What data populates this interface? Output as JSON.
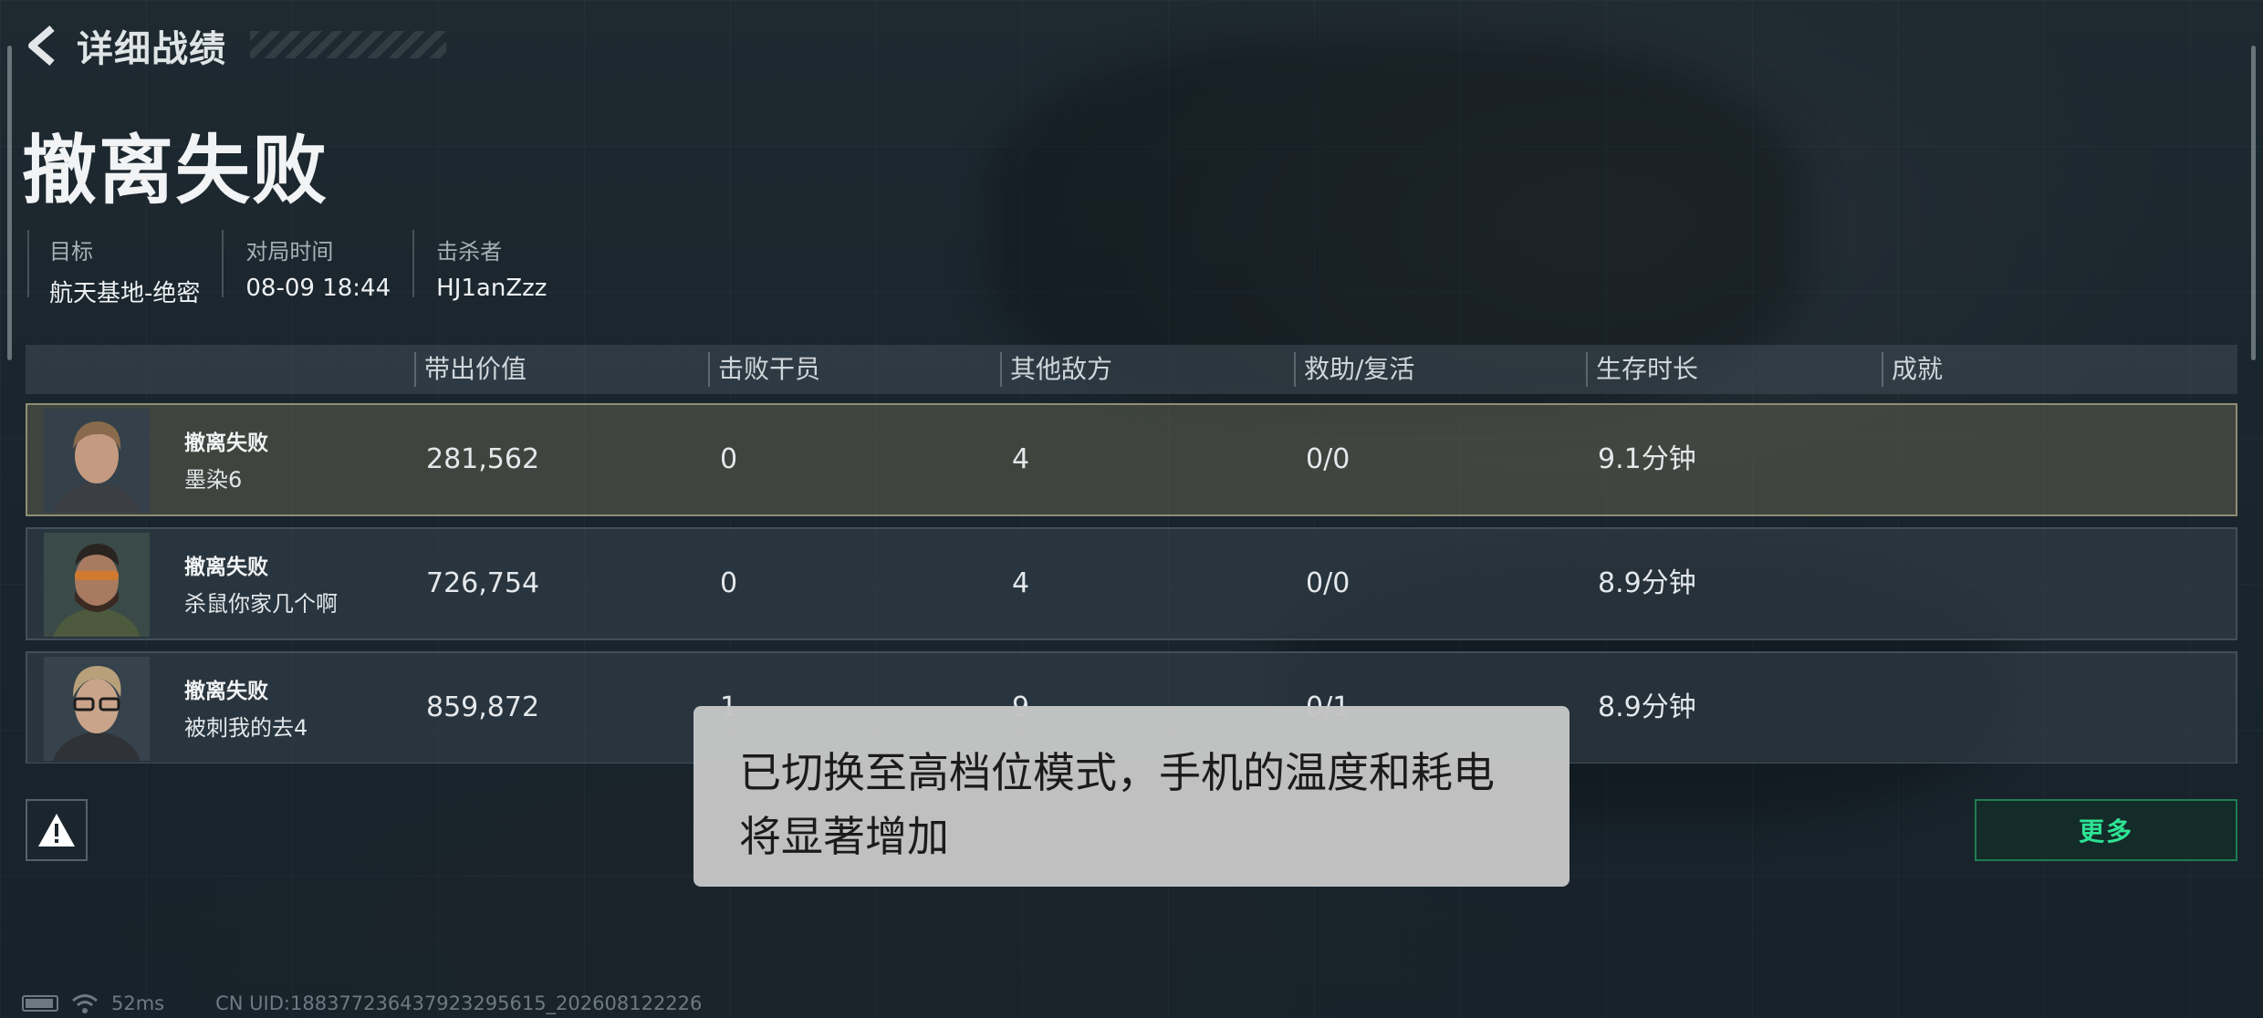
{
  "header": {
    "title": "详细战绩"
  },
  "result_title": "撤离失败",
  "info": [
    {
      "label": "目标",
      "value": "航天基地-绝密"
    },
    {
      "label": "对局时间",
      "value": "08-09 18:44"
    },
    {
      "label": "击杀者",
      "value": "HJ1anZzz"
    }
  ],
  "table": {
    "columns": [
      "带出价值",
      "击败干员",
      "其他敌方",
      "救助/复活",
      "生存时长",
      "成就"
    ],
    "rows": [
      {
        "status": "撤离失败",
        "name": "墨染6",
        "value": "281,562",
        "kills": "0",
        "other": "4",
        "assist": "0/0",
        "time": "9.1分钟",
        "selected": true
      },
      {
        "status": "撤离失败",
        "name": "杀鼠你家几个啊",
        "value": "726,754",
        "kills": "0",
        "other": "4",
        "assist": "0/0",
        "time": "8.9分钟",
        "selected": false
      },
      {
        "status": "撤离失败",
        "name": "被刺我的去4",
        "value": "859,872",
        "kills": "1",
        "other": "9",
        "assist": "0/1",
        "time": "8.9分钟",
        "selected": false
      }
    ]
  },
  "buttons": {
    "more": "更多"
  },
  "toast": {
    "line1": "已切换至高档位模式，手机的温度和耗电",
    "line2": "将显著增加"
  },
  "statusbar": {
    "ping": "52ms",
    "uid": "CN UID:18837723643792329561​5_202608122226"
  },
  "colors": {
    "accent_green": "#2ee394",
    "selected_border": "#8f8d73",
    "toast_bg": "#c4c4c4"
  }
}
